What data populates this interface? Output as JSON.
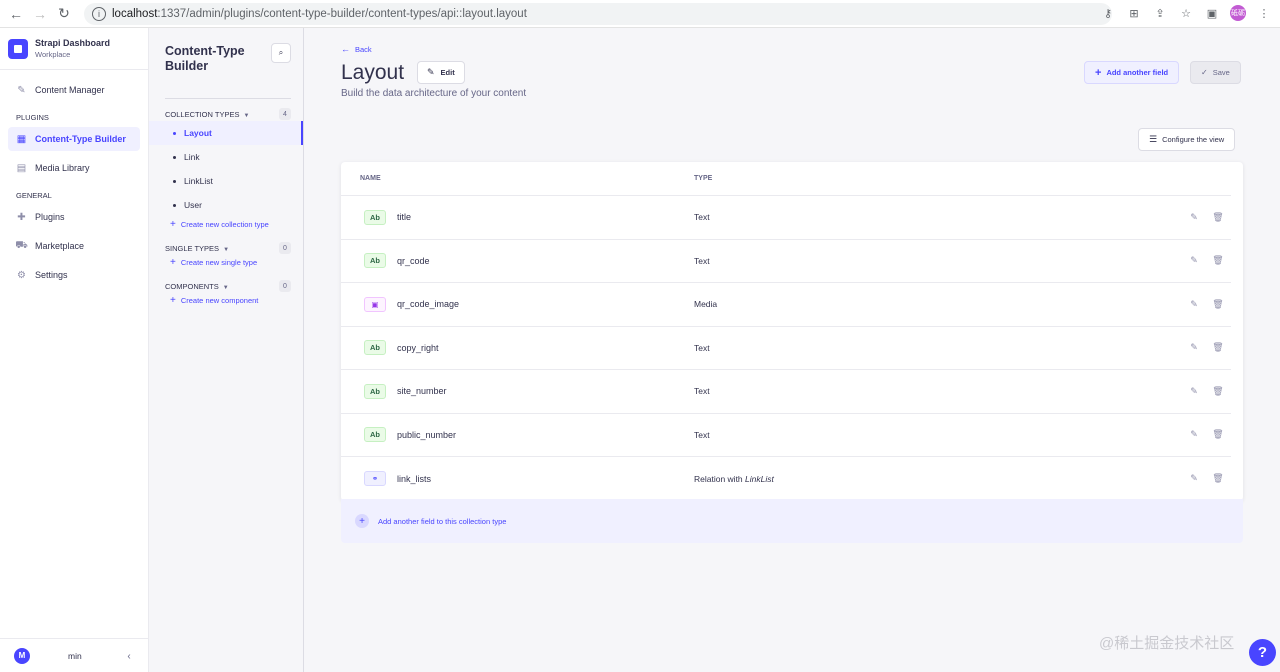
{
  "browser": {
    "url_host": "localhost",
    "url_path": ":1337/admin/plugins/content-type-builder/content-types/api::layout.layout",
    "profile_initials": "砥砺"
  },
  "sidebar": {
    "brand_title": "Strapi Dashboard",
    "brand_subtitle": "Workplace",
    "content_manager": "Content Manager",
    "plugins_section": "PLUGINS",
    "content_type_builder": "Content-Type Builder",
    "media_library": "Media Library",
    "general_section": "GENERAL",
    "plugins": "Plugins",
    "marketplace": "Marketplace",
    "settings": "Settings",
    "user_initial": "M",
    "user_name": "min"
  },
  "subnav": {
    "title": "Content-Type Builder",
    "collection_types": {
      "label": "COLLECTION TYPES",
      "count": "4",
      "items": [
        "Layout",
        "Link",
        "LinkList",
        "User"
      ],
      "create_label": "Create new collection type"
    },
    "single_types": {
      "label": "SINGLE TYPES",
      "count": "0",
      "create_label": "Create new single type"
    },
    "components": {
      "label": "COMPONENTS",
      "count": "0",
      "create_label": "Create new component"
    }
  },
  "header": {
    "back_label": "Back",
    "title": "Layout",
    "edit_label": "Edit",
    "subtitle": "Build the data architecture of your content",
    "add_field_label": "Add another field",
    "save_label": "Save",
    "configure_label": "Configure the view"
  },
  "table": {
    "col_name": "NAME",
    "col_type": "TYPE",
    "rows": [
      {
        "badge": "Ab",
        "name": "title",
        "type": "Text"
      },
      {
        "badge": "Ab",
        "name": "qr_code",
        "type": "Text"
      },
      {
        "badge": "▣",
        "name": "qr_code_image",
        "type": "Media"
      },
      {
        "badge": "Ab",
        "name": "copy_right",
        "type": "Text"
      },
      {
        "badge": "Ab",
        "name": "site_number",
        "type": "Text"
      },
      {
        "badge": "Ab",
        "name": "public_number",
        "type": "Text"
      },
      {
        "badge": "⚭",
        "name": "link_lists",
        "type_prefix": "Relation with",
        "type_target": "LinkList"
      }
    ],
    "add_row_label": "Add another field to this collection type"
  },
  "watermark": "@稀土掘金技术社区",
  "help_label": "?"
}
